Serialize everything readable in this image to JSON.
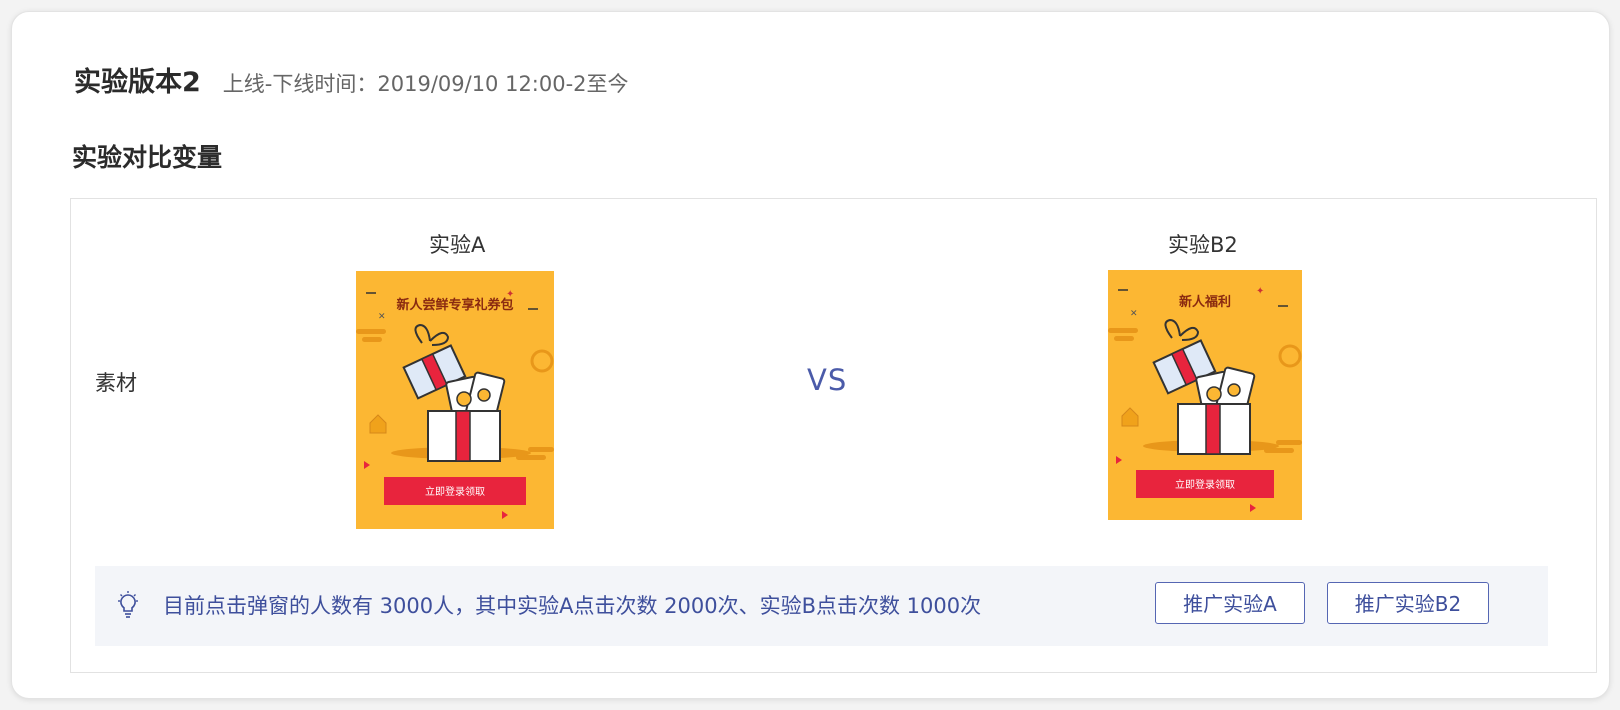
{
  "header": {
    "version_title": "实验版本2",
    "online_time": "上线-下线时间：2019/09/10 12:00-2至今"
  },
  "section_title": "实验对比变量",
  "compare": {
    "row_label": "素材",
    "vs_text": "VS",
    "experiment_a": {
      "label": "实验A",
      "popup_title": "新人尝鲜专享礼券包",
      "popup_button": "立即登录领取"
    },
    "experiment_b": {
      "label": "实验B2",
      "popup_title": "新人福利",
      "popup_button": "立即登录领取"
    }
  },
  "tip": {
    "icon": "lightbulb-icon",
    "text": "目前点击弹窗的人数有 3000人，其中实验A点击次数 2000次、实验B点击次数 1000次"
  },
  "actions": {
    "promote_a": "推广实验A",
    "promote_b": "推广实验B2"
  },
  "colors": {
    "accent": "#3e4f9c",
    "popup_bg": "#fcb733",
    "popup_button": "#e8243d"
  }
}
